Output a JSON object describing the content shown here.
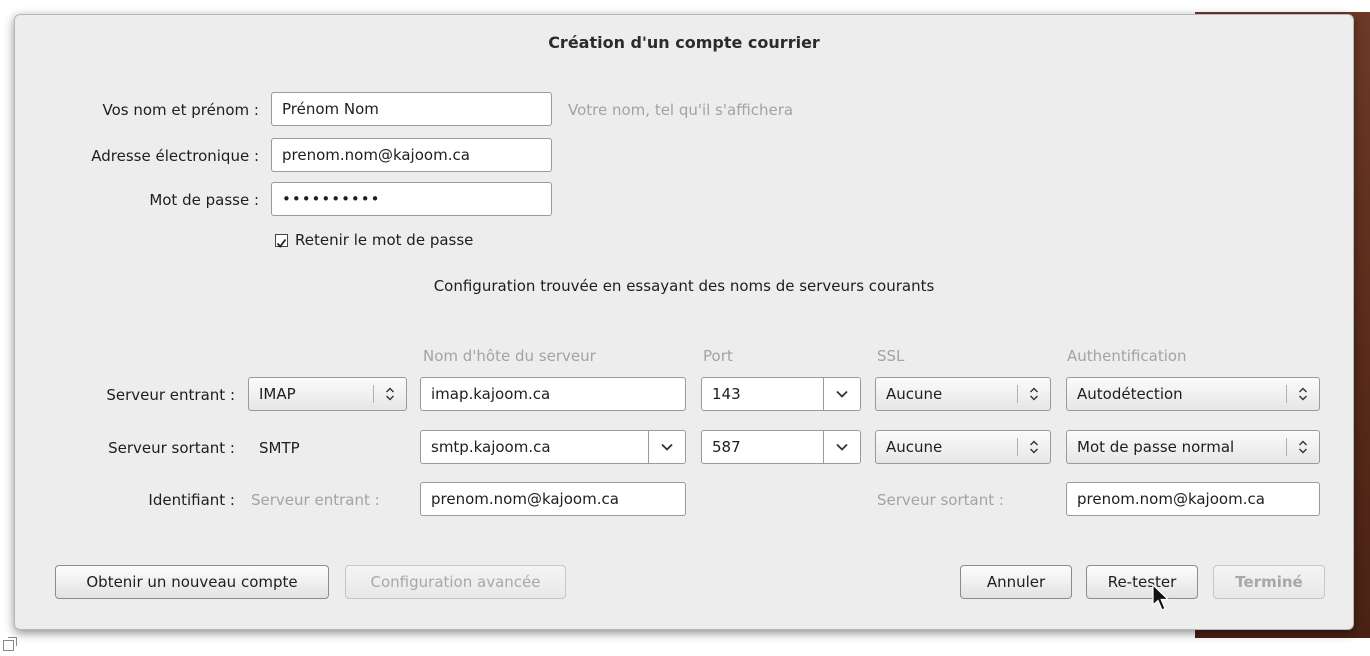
{
  "dialog": {
    "title": "Création d'un compte courrier",
    "name_label": "Vos nom et prénom :",
    "name_value": "Prénom Nom",
    "name_hint": "Votre nom, tel qu'il s'affichera",
    "email_label": "Adresse électronique :",
    "email_value": "prenom.nom@kajoom.ca",
    "password_label": "Mot de passe :",
    "password_value": "••••••••••",
    "remember_label": "Retenir le mot de passe",
    "remember_checked": true,
    "status_text": "Configuration trouvée en essayant des noms de serveurs courants"
  },
  "servers": {
    "headers": {
      "hostname": "Nom d'hôte du serveur",
      "port": "Port",
      "ssl": "SSL",
      "auth": "Authentification"
    },
    "incoming": {
      "label": "Serveur entrant :",
      "protocol": "IMAP",
      "hostname": "imap.kajoom.ca",
      "port": "143",
      "ssl": "Aucune",
      "auth": "Autodétection"
    },
    "outgoing": {
      "label": "Serveur sortant :",
      "protocol": "SMTP",
      "hostname": "smtp.kajoom.ca",
      "port": "587",
      "ssl": "Aucune",
      "auth": "Mot de passe normal"
    },
    "identity": {
      "label": "Identifiant :",
      "incoming_label": "Serveur entrant :",
      "incoming_value": "prenom.nom@kajoom.ca",
      "outgoing_label": "Serveur sortant :",
      "outgoing_value": "prenom.nom@kajoom.ca"
    }
  },
  "buttons": {
    "new_account": "Obtenir un nouveau compte",
    "advanced": "Configuration avancée",
    "cancel": "Annuler",
    "retest": "Re-tester",
    "done": "Terminé"
  },
  "icons": {
    "combo": "chevron-down-icon",
    "spinner": "updown-arrows-icon",
    "cursor": "mouse-pointer-icon",
    "corner": "expand-icon"
  }
}
